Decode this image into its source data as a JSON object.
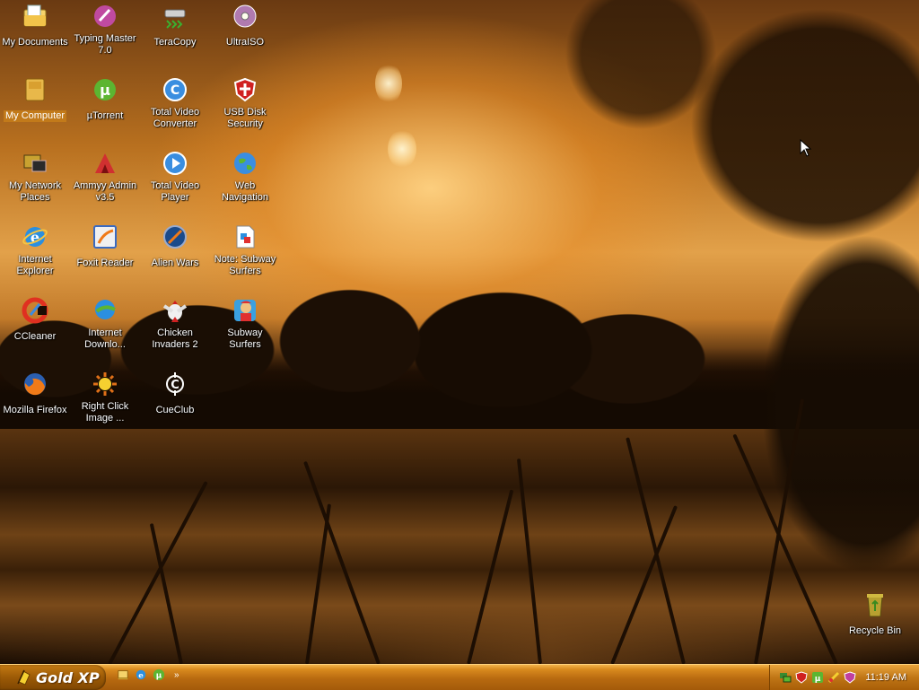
{
  "desktop": {
    "icons": [
      {
        "label": "My Documents",
        "icon": "folder-documents-icon"
      },
      {
        "label": "Typing Master 7.0",
        "icon": "typing-master-icon"
      },
      {
        "label": "TeraCopy",
        "icon": "teracopy-icon"
      },
      {
        "label": "UltraISO",
        "icon": "ultraiso-disc-icon"
      },
      {
        "label": "My Computer",
        "icon": "computer-icon"
      },
      {
        "label": "µTorrent",
        "icon": "utorrent-icon"
      },
      {
        "label": "Total Video Converter",
        "icon": "video-converter-icon"
      },
      {
        "label": "USB Disk Security",
        "icon": "shield-icon"
      },
      {
        "label": "My Network Places",
        "icon": "network-places-icon"
      },
      {
        "label": "Ammyy Admin v3.5",
        "icon": "ammyy-admin-icon"
      },
      {
        "label": "Total Video Player",
        "icon": "video-player-icon"
      },
      {
        "label": "Web Navigation",
        "icon": "globe-icon"
      },
      {
        "label": "Internet Explorer",
        "icon": "internet-explorer-icon"
      },
      {
        "label": "Foxit Reader",
        "icon": "foxit-reader-icon"
      },
      {
        "label": "Alien Wars",
        "icon": "alien-wars-icon"
      },
      {
        "label": "Note: Subway Surfers",
        "icon": "note-file-icon"
      },
      {
        "label": "CCleaner",
        "icon": "ccleaner-icon"
      },
      {
        "label": "Internet Downlo...",
        "icon": "internet-download-manager-icon"
      },
      {
        "label": "Chicken Invaders 2",
        "icon": "chicken-invaders-icon"
      },
      {
        "label": "Subway Surfers",
        "icon": "subway-surfers-icon"
      },
      {
        "label": "Mozilla Firefox",
        "icon": "firefox-icon"
      },
      {
        "label": "Right Click Image ...",
        "icon": "right-click-image-icon"
      },
      {
        "label": "CueClub",
        "icon": "cueclub-icon"
      },
      {
        "label": "Recycle Bin",
        "icon": "recycle-bin-icon"
      }
    ],
    "selected": "My Computer"
  },
  "taskbar": {
    "start_label": "Gold XP",
    "quick_launch": [
      "show-desktop-icon",
      "internet-explorer-icon",
      "utorrent-icon"
    ],
    "tray_icons": [
      "network-icon",
      "shield-icon",
      "utorrent-icon",
      "antivirus-icon",
      "volume-icon"
    ],
    "clock": "11:19 AM"
  },
  "colors": {
    "taskbar": "#c07616",
    "start_button": "#9c5a06",
    "selection": "#c27a1a"
  }
}
